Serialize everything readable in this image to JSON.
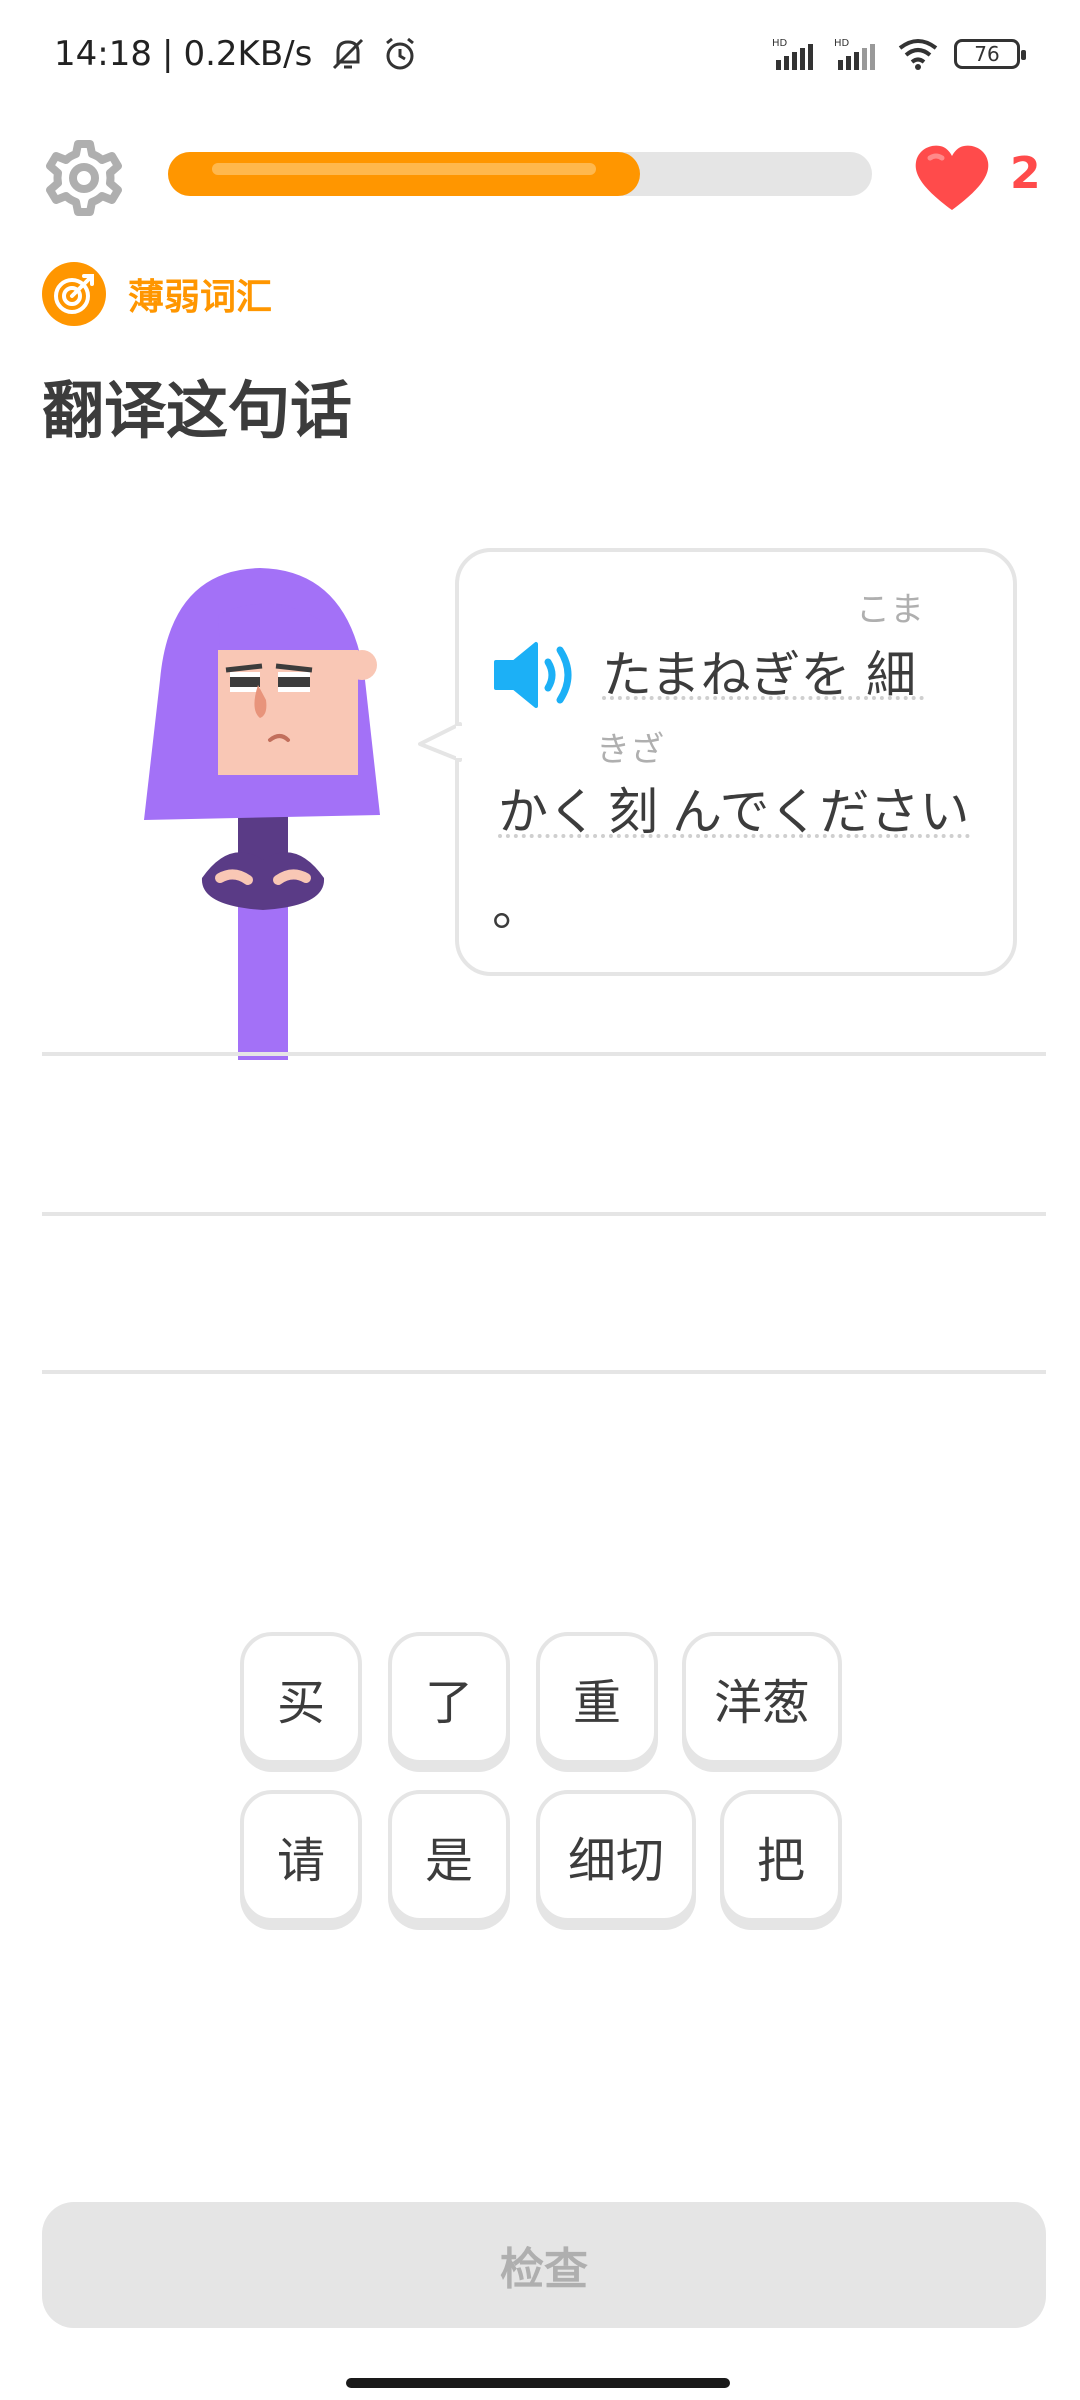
{
  "status_bar": {
    "time": "14:18",
    "separator": "|",
    "net_speed": "0.2KB/s",
    "battery": "76",
    "signal_1_label": "HD",
    "signal_2_label": "HD"
  },
  "progress": {
    "fraction": 0.67
  },
  "hearts": {
    "count": "2"
  },
  "badge": {
    "label": "薄弱词汇"
  },
  "title": "翻译这句话",
  "prompt": {
    "line1": "たまねぎを",
    "line1_kanji": "細",
    "furigana_1": "こま",
    "line2_pre": "かく",
    "line2_kanji": "刻",
    "furigana_2": "きざ",
    "line2_post": "んでください",
    "line3": "。"
  },
  "word_bank": {
    "row1": [
      "买",
      "了",
      "重",
      "洋葱"
    ],
    "row2": [
      "请",
      "是",
      "细切",
      "把"
    ]
  },
  "check_button": {
    "label": "检查"
  },
  "colors": {
    "accent": "#ff9600",
    "heart": "#ff4b4b",
    "speaker": "#1cb0f6",
    "character_hair": "#a371f7",
    "border": "#e5e5e5"
  },
  "icons": {
    "settings": "gear-icon",
    "heart": "heart-icon",
    "badge": "target-icon",
    "speaker": "speaker-icon"
  }
}
